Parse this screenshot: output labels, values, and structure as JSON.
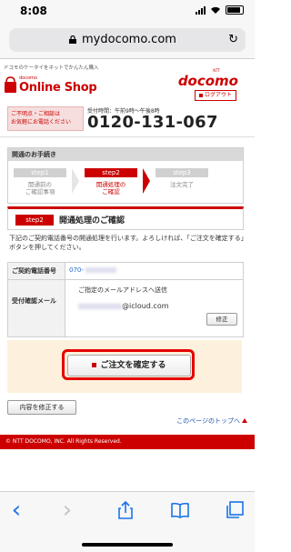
{
  "status_bar": {
    "time": "8:08"
  },
  "browser": {
    "url": "mydocomo.com"
  },
  "header": {
    "tagline": "ドコモのケータイをネットでかんたん購入",
    "logo_small": "docomo",
    "logo_main": "Online Shop",
    "brand": "docomo",
    "brand_ntt": "NTT",
    "logout": "ログアウト",
    "contact_line1": "ご不明点・ご相談は",
    "contact_line2": "お気軽にお電話ください",
    "hours": "受付時間：午前9時～午後8時",
    "phone": "0120-131-067"
  },
  "steps": {
    "heading": "開通のお手続き",
    "items": [
      {
        "tag": "step1",
        "label_line1": "開通前の",
        "label_line2": "ご確認事項"
      },
      {
        "tag": "step2",
        "label_line1": "開通処理の",
        "label_line2": "ご確認"
      },
      {
        "tag": "step3",
        "label_line1": "注文完了",
        "label_line2": ""
      }
    ]
  },
  "section": {
    "tag": "step2",
    "title": "開通処理のご確認"
  },
  "intro": "下記のご契約電話番号の開通処理を行います。よろしければ、「ご注文を確定する」ボタンを押してください。",
  "table": {
    "phone_label": "ご契約電話番号",
    "phone_value": "070-",
    "mail_label": "受付確認メール",
    "mail_note": "ご指定のメールアドレスへ送信",
    "mail_domain": "@icloud.com",
    "fix_button": "修正"
  },
  "confirm_button": "ご注文を確定する",
  "edit_button": "内容を修正する",
  "top_link": "このページのトップへ",
  "footer": "© NTT DOCOMO, INC. All Rights Reserved.",
  "toolbar": {
    "back": "‹",
    "forward": "›"
  }
}
